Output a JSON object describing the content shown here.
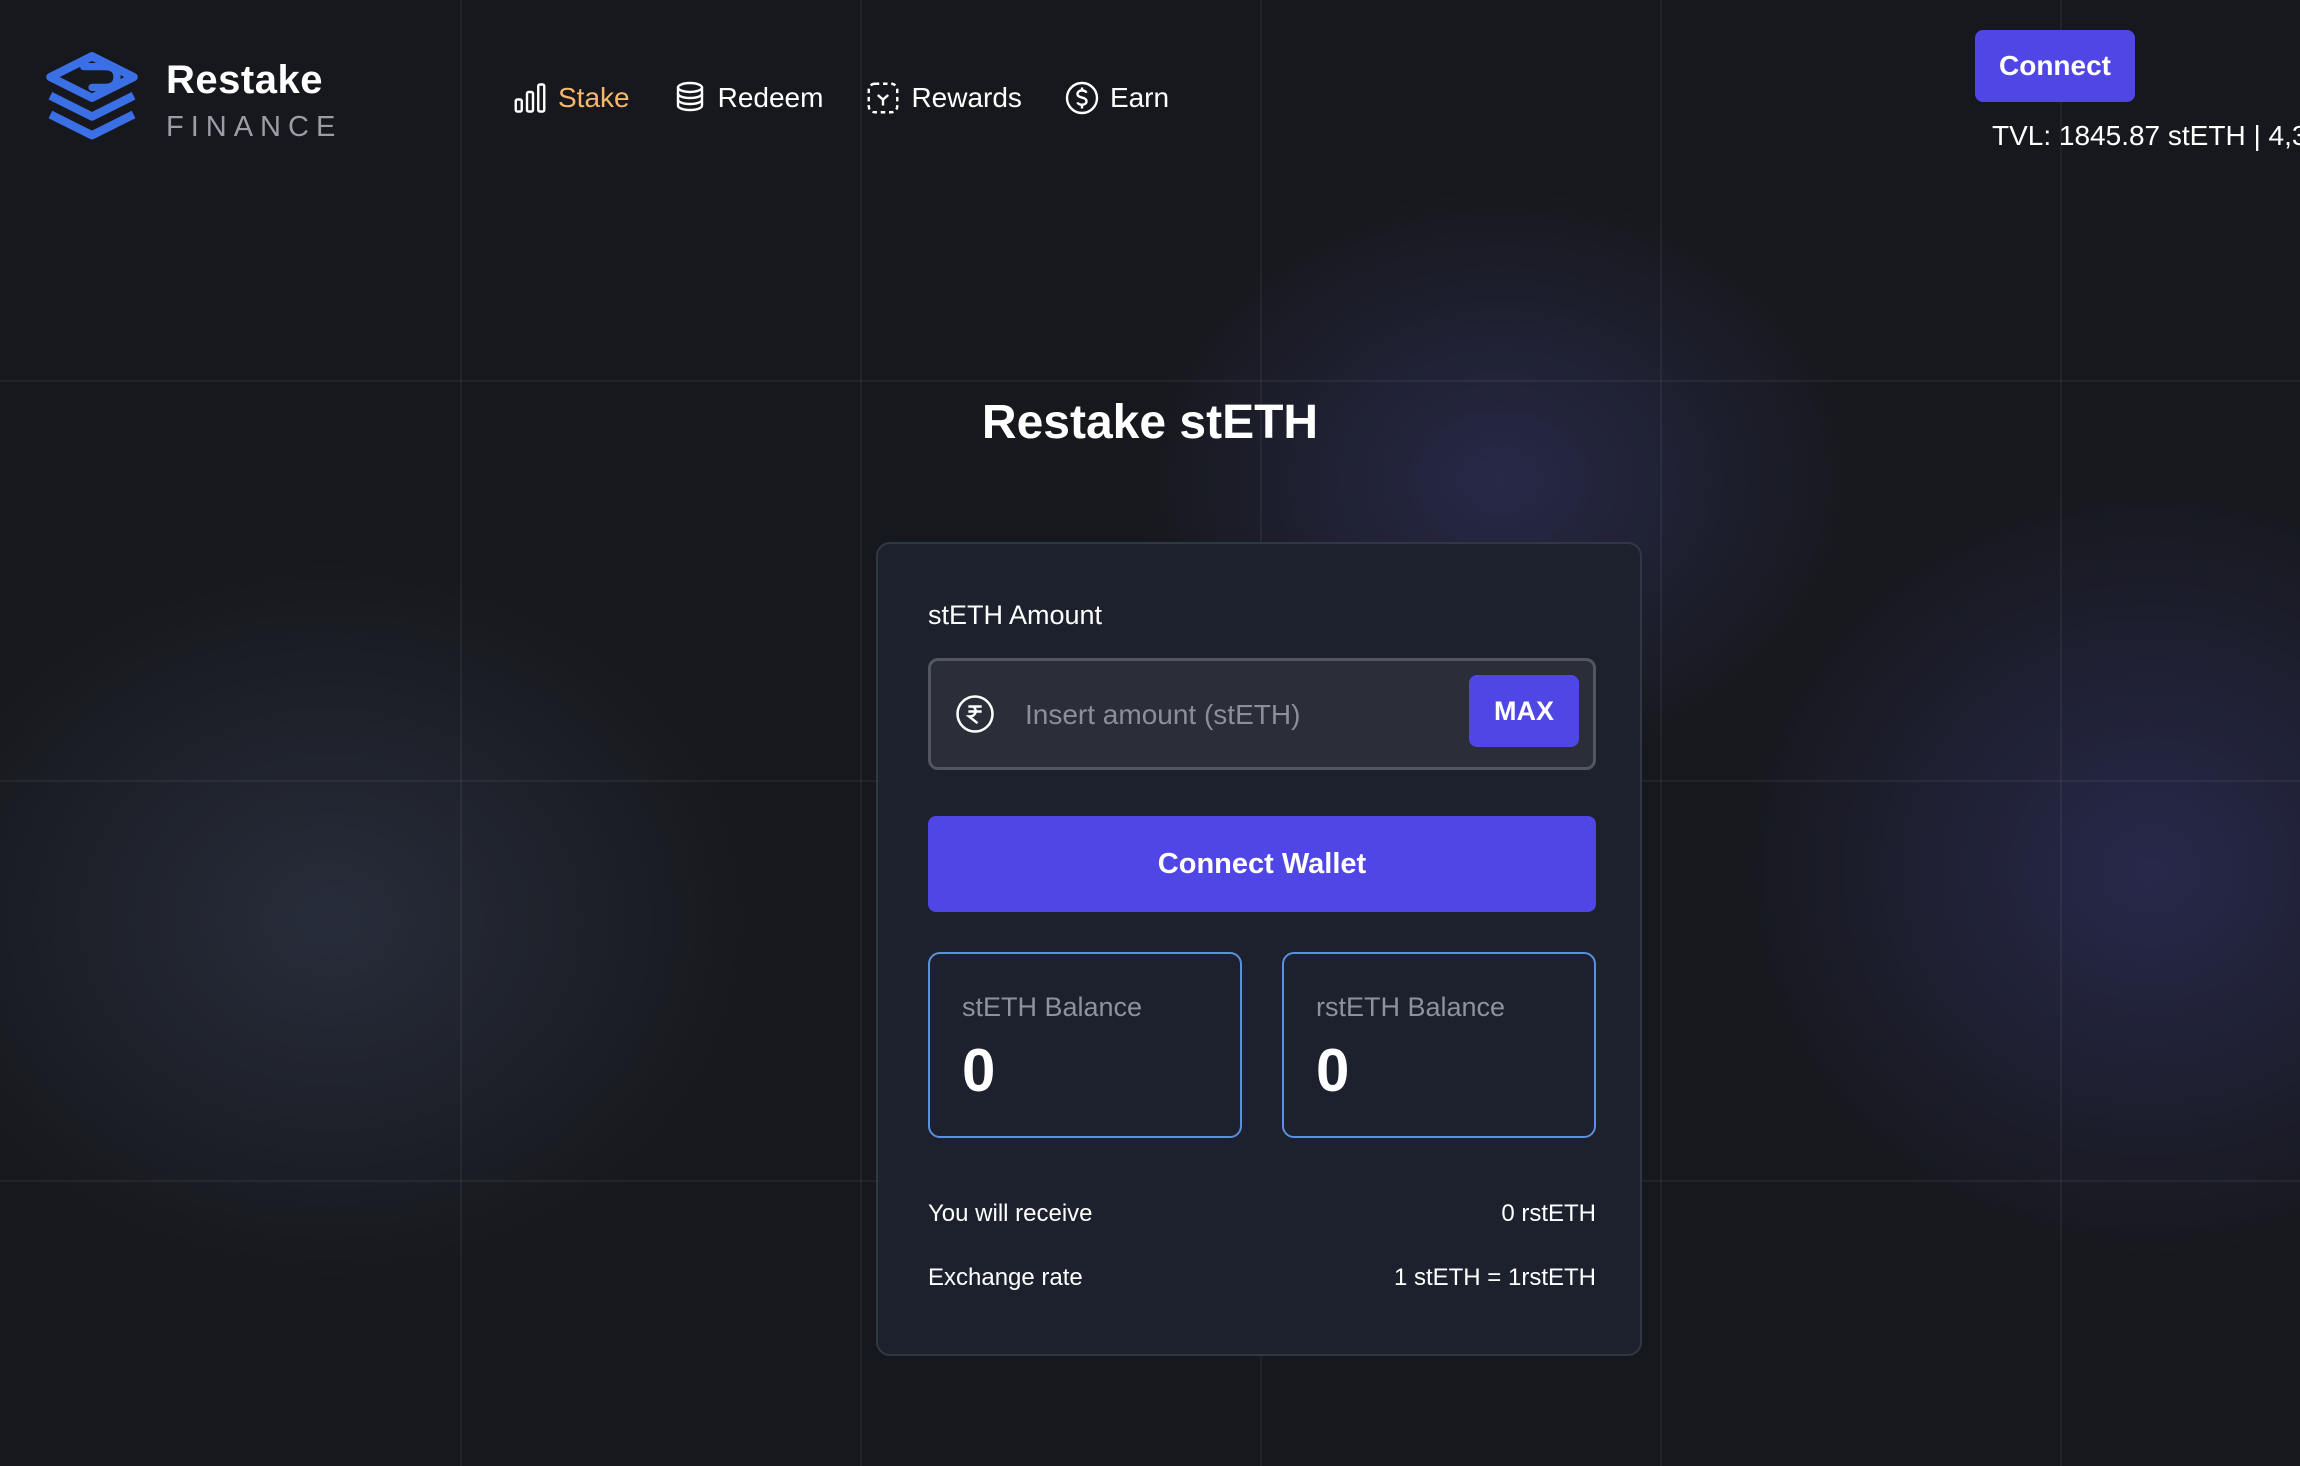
{
  "brand": {
    "name": "Restake",
    "sub": "FINANCE",
    "accent": "#3b6fe6"
  },
  "nav": {
    "items": [
      {
        "label": "Stake",
        "icon": "bar-chart-icon",
        "active": true
      },
      {
        "label": "Redeem",
        "icon": "coins-stack-icon",
        "active": false
      },
      {
        "label": "Rewards",
        "icon": "reward-frame-icon",
        "active": false
      },
      {
        "label": "Earn",
        "icon": "dollar-circle-icon",
        "active": false
      }
    ],
    "active_color": "#f5b76b"
  },
  "header": {
    "connect_label": "Connect",
    "tvl_text": "TVL: 1845.87 stETH | 4,3"
  },
  "main": {
    "title": "Restake stETH"
  },
  "form": {
    "amount_label": "stETH Amount",
    "amount_placeholder": "Insert amount (stETH)",
    "amount_value": "",
    "max_label": "MAX",
    "connect_wallet_label": "Connect Wallet"
  },
  "balances": {
    "steth_label": "stETH Balance",
    "steth_value": "0",
    "rsteth_label": "rstETH Balance",
    "rsteth_value": "0"
  },
  "summary": {
    "receive_label": "You will receive",
    "receive_value": "0 rstETH",
    "rate_label": "Exchange rate",
    "rate_value": "1 stETH = 1rstETH"
  },
  "colors": {
    "primary_button": "#4f46e5",
    "balance_border": "#5b8fe0",
    "background": "#17181d"
  }
}
